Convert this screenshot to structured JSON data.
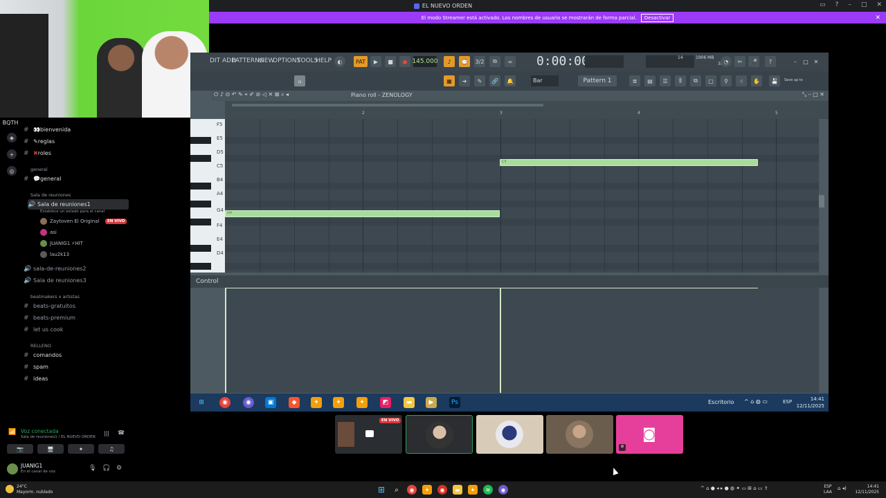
{
  "window": {
    "title": "EL NUEVO ORDEN"
  },
  "streamer_banner": {
    "text": "El modo Streamer está activado. Los nombres de usuario se mostrarán de forma parcial.",
    "button": "Desactivar"
  },
  "server": {
    "name": "BQTH",
    "channels": [
      {
        "label": "bienvenida",
        "icon": "👀"
      },
      {
        "label": "reglas",
        "icon": "✎"
      },
      {
        "label": "roles",
        "icon": "✖"
      }
    ],
    "category_general": "general",
    "general_channel": "general",
    "category_voice": "Sala de reuniones",
    "voice_active": "Sala de reuniones1",
    "voice_status": "Establece un estado para el canal",
    "voice_users": [
      {
        "name": "Zaytoven El Original",
        "live": "EN VIVO"
      },
      {
        "name": "asi"
      },
      {
        "name": "JUANIG1 ⚡HIT"
      },
      {
        "name": "lau2k13"
      }
    ],
    "voice_channels_more": [
      "sala-de-reuniones2",
      "Sala de reuniones3"
    ],
    "category_beat": "beatmakers x artistas",
    "beat_channels": [
      "beats-gratuitos",
      "beats-premium",
      "let us cook"
    ],
    "category_relleno": "RELLENO",
    "relleno_channels": [
      "comandos",
      "spam",
      "ideas"
    ]
  },
  "voice_panel": {
    "status": "Voz conectada",
    "sub": "Sala de reuniones1 / EL NUEVO ORDEN"
  },
  "user_panel": {
    "name": "JUANIG1",
    "status": "En el canal de voz"
  },
  "fl": {
    "menu": [
      "DIT",
      "ADD",
      "PATTERNS",
      "VIEW",
      "OPTIONS",
      "TOOLS",
      "HELP"
    ],
    "bpm": "145.000",
    "time": "0:00:00",
    "mem": "1906 MB",
    "cpu": "14",
    "poly": "36",
    "pattern": "Pattern 1",
    "snap": "Bar",
    "piano_roll_title": "Piano roll - ZENOLOGY",
    "ruler": [
      "2",
      "3",
      "4",
      "5"
    ],
    "keys": [
      "F5",
      "E5",
      "D5",
      "C5",
      "B4",
      "A4",
      "G4",
      "F4",
      "E4",
      "D4"
    ],
    "control_label": "Control",
    "save_label": "Save up to",
    "note1": "C5",
    "note2": "G4"
  },
  "inner_taskbar": {
    "label": "Escritorio",
    "lang": "ESP",
    "time": "14:41",
    "date": "12/11/2025"
  },
  "tiles": {
    "live_badge": "EN VIVO"
  },
  "taskbar": {
    "weather_temp": "24°C",
    "weather_desc": "Mayorm. nublado",
    "lang": "ESP",
    "lang2": "LAA",
    "time": "14:41",
    "date": "12/11/2025"
  }
}
